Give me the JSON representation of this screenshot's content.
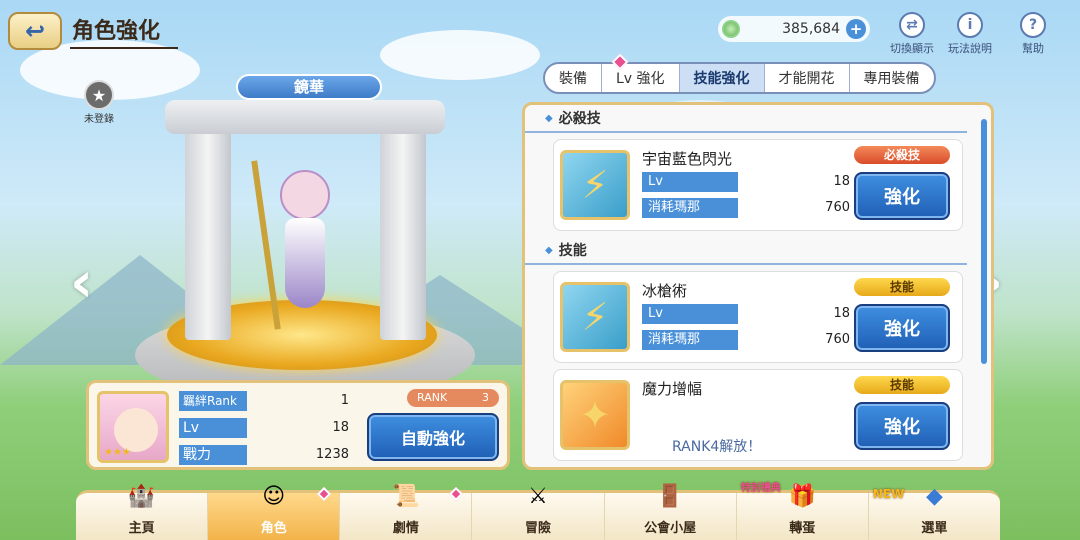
{
  "header": {
    "title": "角色強化",
    "back_icon": "back-arrow-icon"
  },
  "currency": {
    "value": "385,684",
    "icon": "gem-icon",
    "plus": "+"
  },
  "top_icons": [
    {
      "label": "切換顯示",
      "icon": "swap-icon",
      "glyph": "⇄"
    },
    {
      "label": "玩法說明",
      "icon": "info-icon",
      "glyph": "i"
    },
    {
      "label": "幫助",
      "icon": "help-icon",
      "glyph": "?"
    }
  ],
  "tabs": [
    "裝備",
    "Lv 強化",
    "技能強化",
    "才能開花",
    "專用裝備"
  ],
  "active_tab": 2,
  "character": {
    "name": "鏡華",
    "unregistered": "未登錄"
  },
  "skills_panel": {
    "section_ub": "必殺技",
    "section_skill": "技能",
    "ub": {
      "name": "宇宙藍色閃光",
      "badge": "必殺技",
      "lv_label": "Lv",
      "lv": "18",
      "cost_label": "消耗瑪那",
      "cost": "760",
      "button": "強化"
    },
    "skill1": {
      "name": "冰槍術",
      "badge": "技能",
      "lv_label": "Lv",
      "lv": "18",
      "cost_label": "消耗瑪那",
      "cost": "760",
      "button": "強化"
    },
    "skill2": {
      "name": "魔力增幅",
      "badge": "技能",
      "unlock": "RANK4解放！",
      "button": "強化"
    }
  },
  "info": {
    "bond_label": "羈絆Rank",
    "bond": "1",
    "lv_label": "Lv",
    "lv": "18",
    "power_label": "戰力",
    "power": "1238",
    "rank_label": "RANK",
    "rank": "3",
    "auto_button": "自動強化"
  },
  "nav": [
    {
      "label": "主頁",
      "icon": "castle-icon",
      "glyph": "🏰"
    },
    {
      "label": "角色",
      "icon": "character-icon",
      "glyph": "☺"
    },
    {
      "label": "劇情",
      "icon": "scroll-icon",
      "glyph": "📜"
    },
    {
      "label": "冒險",
      "icon": "sword-flag-icon",
      "glyph": "⚔"
    },
    {
      "label": "公會小屋",
      "icon": "house-door-icon",
      "glyph": "🚪"
    },
    {
      "label": "轉蛋",
      "icon": "gacha-icon",
      "glyph": "🎁"
    },
    {
      "label": "選單",
      "icon": "crystal-icon",
      "glyph": "◆"
    }
  ],
  "nav_new_tag": "NEW",
  "nav_special_tag": "特別禮典",
  "colors": {
    "accent": "#4a90d9",
    "button": "#1f5fb5",
    "gold": "#e2c27a"
  }
}
